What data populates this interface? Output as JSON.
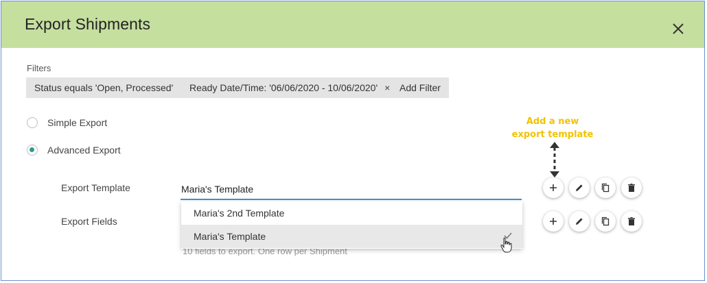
{
  "dialog": {
    "title": "Export Shipments"
  },
  "filters": {
    "label": "Filters",
    "chips": [
      {
        "text": "Status equals 'Open, Processed'"
      },
      {
        "text": "Ready Date/Time: '06/06/2020 - 10/06/2020'"
      }
    ],
    "add_filter_label": "Add Filter",
    "remove_glyph": "×"
  },
  "export_mode": {
    "options": [
      {
        "label": "Simple Export",
        "checked": false
      },
      {
        "label": "Advanced Export",
        "checked": true
      }
    ]
  },
  "export_template": {
    "label": "Export Template",
    "value": "Maria's Template",
    "dropdown_options": [
      {
        "label": "Maria's 2nd Template",
        "selected": false
      },
      {
        "label": "Maria's Template",
        "selected": true
      }
    ]
  },
  "export_fields": {
    "label": "Export Fields",
    "helper_text": "10 fields to export. One row per Shipment"
  },
  "annotation": {
    "line1": "Add a new",
    "line2": "export template",
    "color": "#f2c200"
  },
  "colors": {
    "header_bg": "#c5df9f",
    "accent": "#2a9d8f",
    "input_underline": "#3f8fd4"
  }
}
